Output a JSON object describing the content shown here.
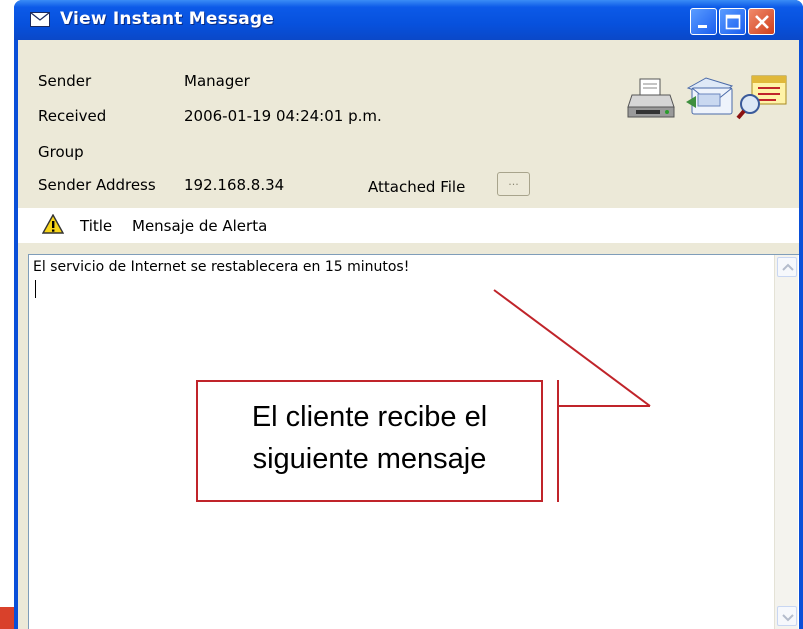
{
  "window": {
    "title": "View Instant Message",
    "icon": "envelope-icon"
  },
  "fields": {
    "sender_label": "Sender",
    "sender_value": "Manager",
    "received_label": "Received",
    "received_value": "2006-01-19 04:24:01 p.m.",
    "group_label": "Group",
    "address_label": "Sender Address",
    "address_value": "192.168.8.34",
    "attached_label": "Attached File",
    "attached_button": "..."
  },
  "toolbar": {
    "icons": [
      "printer-icon",
      "reply-icon",
      "view-message-icon"
    ]
  },
  "title_row": {
    "label": "Title",
    "value": "Mensaje de Alerta",
    "icon": "warning-icon"
  },
  "message": {
    "text": "El servicio de Internet se restablecera en 15 minutos!"
  },
  "callout": {
    "line1": "El cliente recibe el",
    "line2": "siguiente mensaje"
  },
  "colors": {
    "titlebar": "#0751dd",
    "client_bg": "#ece9d8",
    "callout_border": "#c0242a",
    "close_button": "#d0401e"
  }
}
